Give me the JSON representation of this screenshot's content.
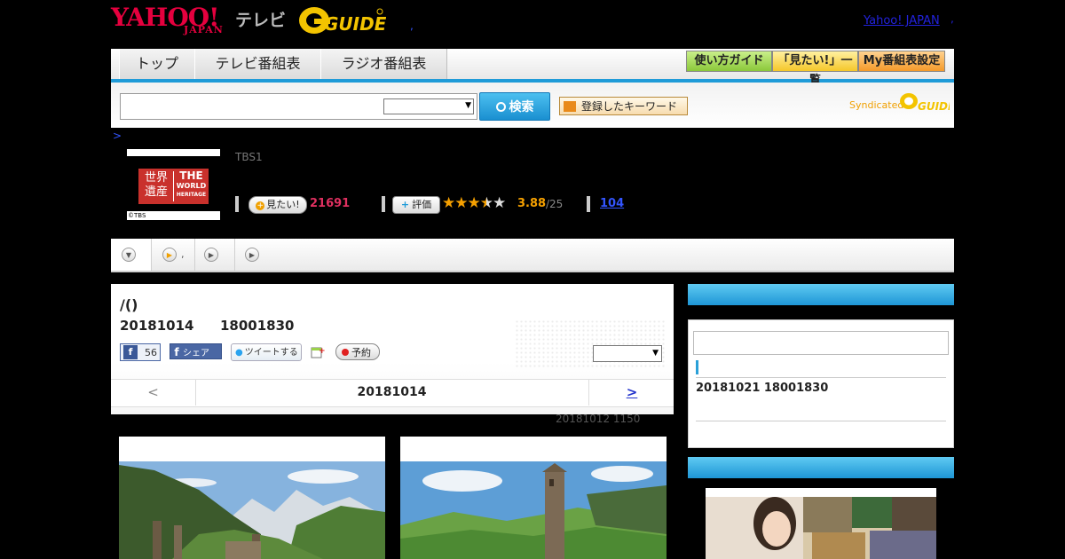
{
  "header": {
    "logo_yahoo": "YAHOO!",
    "logo_japan": "JAPAN",
    "logo_tv": "テレビ",
    "logo_gguide": "G GUIDE",
    "dot": ",",
    "yahoo_japan_link": "Yahoo! JAPAN",
    "yahoo_japan_dot": ","
  },
  "nav": {
    "tabs": [
      "トップ",
      "テレビ番組表",
      "ラジオ番組表"
    ],
    "buttons": [
      {
        "label": "使い方ガイド",
        "color": "#9bd24a"
      },
      {
        "label": "「見たい!」一覧",
        "color": "#ffd84a"
      },
      {
        "label": "My番組表設定",
        "color": "#ffae3a"
      }
    ]
  },
  "search": {
    "input_value": "",
    "select_value": "",
    "button_label": "検索",
    "keyword_button_label": "登録したキーワード",
    "syndicated_label": "Syndicated",
    "syndicated_logo": "G GUIDE"
  },
  "breadcrumb": {
    "text": ">"
  },
  "program": {
    "logo_left": "世界遺産",
    "logo_right_1": "THE",
    "logo_right_2": "WORLD",
    "logo_right_3": "HERITAGE",
    "logo_copyright": "©TBS",
    "channel": "TBS1",
    "want_label": "見たい!",
    "want_count": "21691",
    "rate_label": "評価",
    "rating": 3.88,
    "rating_text": "3.88",
    "rating_max": "/25",
    "review_count": "104"
  },
  "tabs": {
    "tab2_text": ","
  },
  "detail": {
    "title": "/()",
    "date": "20181014",
    "time": "18001830",
    "like_count": "56",
    "share_label": "シェア",
    "tweet_label": "ツイートする",
    "reserve_label": "予約",
    "select_value": "",
    "pager_prev": "<",
    "pager_date": "20181014",
    "pager_next": ">",
    "update_note": "20181012  1150"
  },
  "sidebar": {
    "next_date": "20181021  18001830"
  },
  "colors": {
    "accent_blue": "#1f9bd8",
    "yahoo_red": "#e5003e",
    "want_pink": "#e03060",
    "rating_orange": "#f5a000"
  }
}
